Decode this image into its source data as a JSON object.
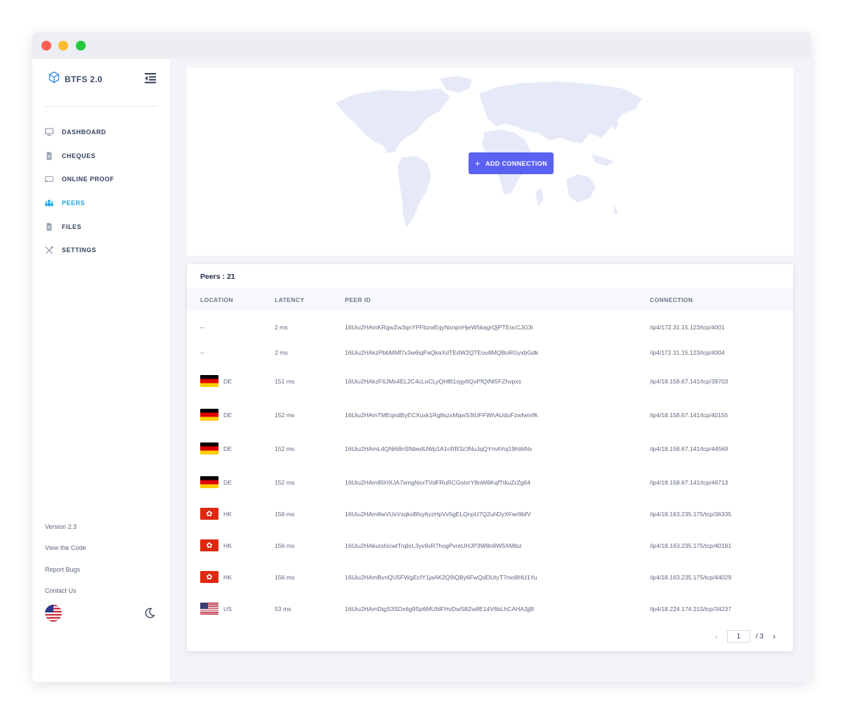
{
  "window": {
    "controls": [
      "close",
      "minimize",
      "maximize"
    ]
  },
  "sidebar": {
    "brand": "BTFS 2.0",
    "nav": [
      {
        "label": "DASHBOARD",
        "icon": "monitor-icon",
        "active": false
      },
      {
        "label": "CHEQUES",
        "icon": "cheque-icon",
        "active": false
      },
      {
        "label": "ONLINE PROOF",
        "icon": "cast-icon",
        "active": false
      },
      {
        "label": "PEERS",
        "icon": "peers-icon",
        "active": true
      },
      {
        "label": "FILES",
        "icon": "file-icon",
        "active": false
      },
      {
        "label": "SETTINGS",
        "icon": "tools-icon",
        "active": false
      }
    ],
    "version": "Version 2.3",
    "links": [
      "View the Code",
      "Report Bugs",
      "Contact Us"
    ],
    "language_flag": "us-flag-icon",
    "theme_toggle": "moon-icon"
  },
  "map": {
    "add_button": "ADD CONNECTION",
    "add_icon": "+"
  },
  "peers": {
    "title": "Peers : 21",
    "columns": [
      "LOCATION",
      "LATENCY",
      "PEER ID",
      "CONNECTION"
    ],
    "rows": [
      {
        "flag": "",
        "country": "--",
        "latency": "2 ms",
        "peer_id": "16Uiu2HAmKRgwZw3qnYPFbzwEqyNxnpnHjeW5kagrQjPTEocCJG3i",
        "connection": "/ip4/172.31.15.123/tcp/4001"
      },
      {
        "flag": "",
        "country": "--",
        "latency": "2 ms",
        "peer_id": "16Uiu2HAkzPbbMMf7x3w6iqPaQkaXdTEdW2QTEou8MQBoRGyxbGdk",
        "connection": "/ip4/172.31.15.123/tcp/4004"
      },
      {
        "flag": "de",
        "country": "DE",
        "latency": "151 ms",
        "peer_id": "16Uiu2HAkzF6JMx4EL2C4cLoCLyQH8t1sgyttQxPfQtNt5FZhvpxs",
        "connection": "/ip4/18.158.67.141/tcp/39703"
      },
      {
        "flag": "de",
        "country": "DE",
        "latency": "152 ms",
        "peer_id": "16Uiu2HAmTMEqndByECXuxk1Rg8szxMqwS3tUFFWhAUduFzwfwmfK",
        "connection": "/ip4/18.158.67.141/tcp/40155"
      },
      {
        "flag": "de",
        "country": "DE",
        "latency": "152 ms",
        "peer_id": "16Uiu2HAmL4QNi68nSNbedUWp1A1cRR3z3NuJqQYmAYoj19ht6iNv",
        "connection": "/ip4/18.158.67.141/tcp/44569"
      },
      {
        "flag": "de",
        "country": "DE",
        "latency": "152 ms",
        "peer_id": "16Uiu2HAm85HXJA7xmgNxxTVdFRuRCGstvrY8nW6KqfTtkuZrZg64",
        "connection": "/ip4/18.158.67.141/tcp/46713"
      },
      {
        "flag": "hk",
        "country": "HK",
        "latency": "156 ms",
        "peer_id": "16Uiu2HAm8wVUsVsqksBfxy6yzHpVv5gELQnpU7Q2uhDyXFwr9bfV",
        "connection": "/ip4/18.163.235.175/tcp/36335"
      },
      {
        "flag": "hk",
        "country": "HK",
        "latency": "156 ms",
        "peer_id": "16Uiu2HAkurshicwtTrqbrL3yv9xR7hogPvreUHJP3W8n9W5XMibz",
        "connection": "/ip4/18.163.235.175/tcp/40191"
      },
      {
        "flag": "hk",
        "country": "HK",
        "latency": "156 ms",
        "peer_id": "16Uiu2HAmBvnQU5FWgEcfY1jaAK2Q9iQBy6FwQdDUtyT7mo8HU1Yu",
        "connection": "/ip4/18.163.235.175/tcp/44029"
      },
      {
        "flag": "us",
        "country": "US",
        "latency": "53 ms",
        "peer_id": "16Uiu2HAmDigS3SDx6g9Sp6MUfdFHvDwS8Zw8E14V6bLhCAHA3jjB",
        "connection": "/ip4/18.224.174.215/tcp/34237"
      }
    ],
    "pagination": {
      "current": "1",
      "total_label": "/ 3",
      "prev_icon": "‹",
      "next_icon": "›"
    }
  },
  "colors": {
    "accent": "#1ea6e6",
    "button": "#5b61f1",
    "map_land": "#e6e9f8"
  }
}
